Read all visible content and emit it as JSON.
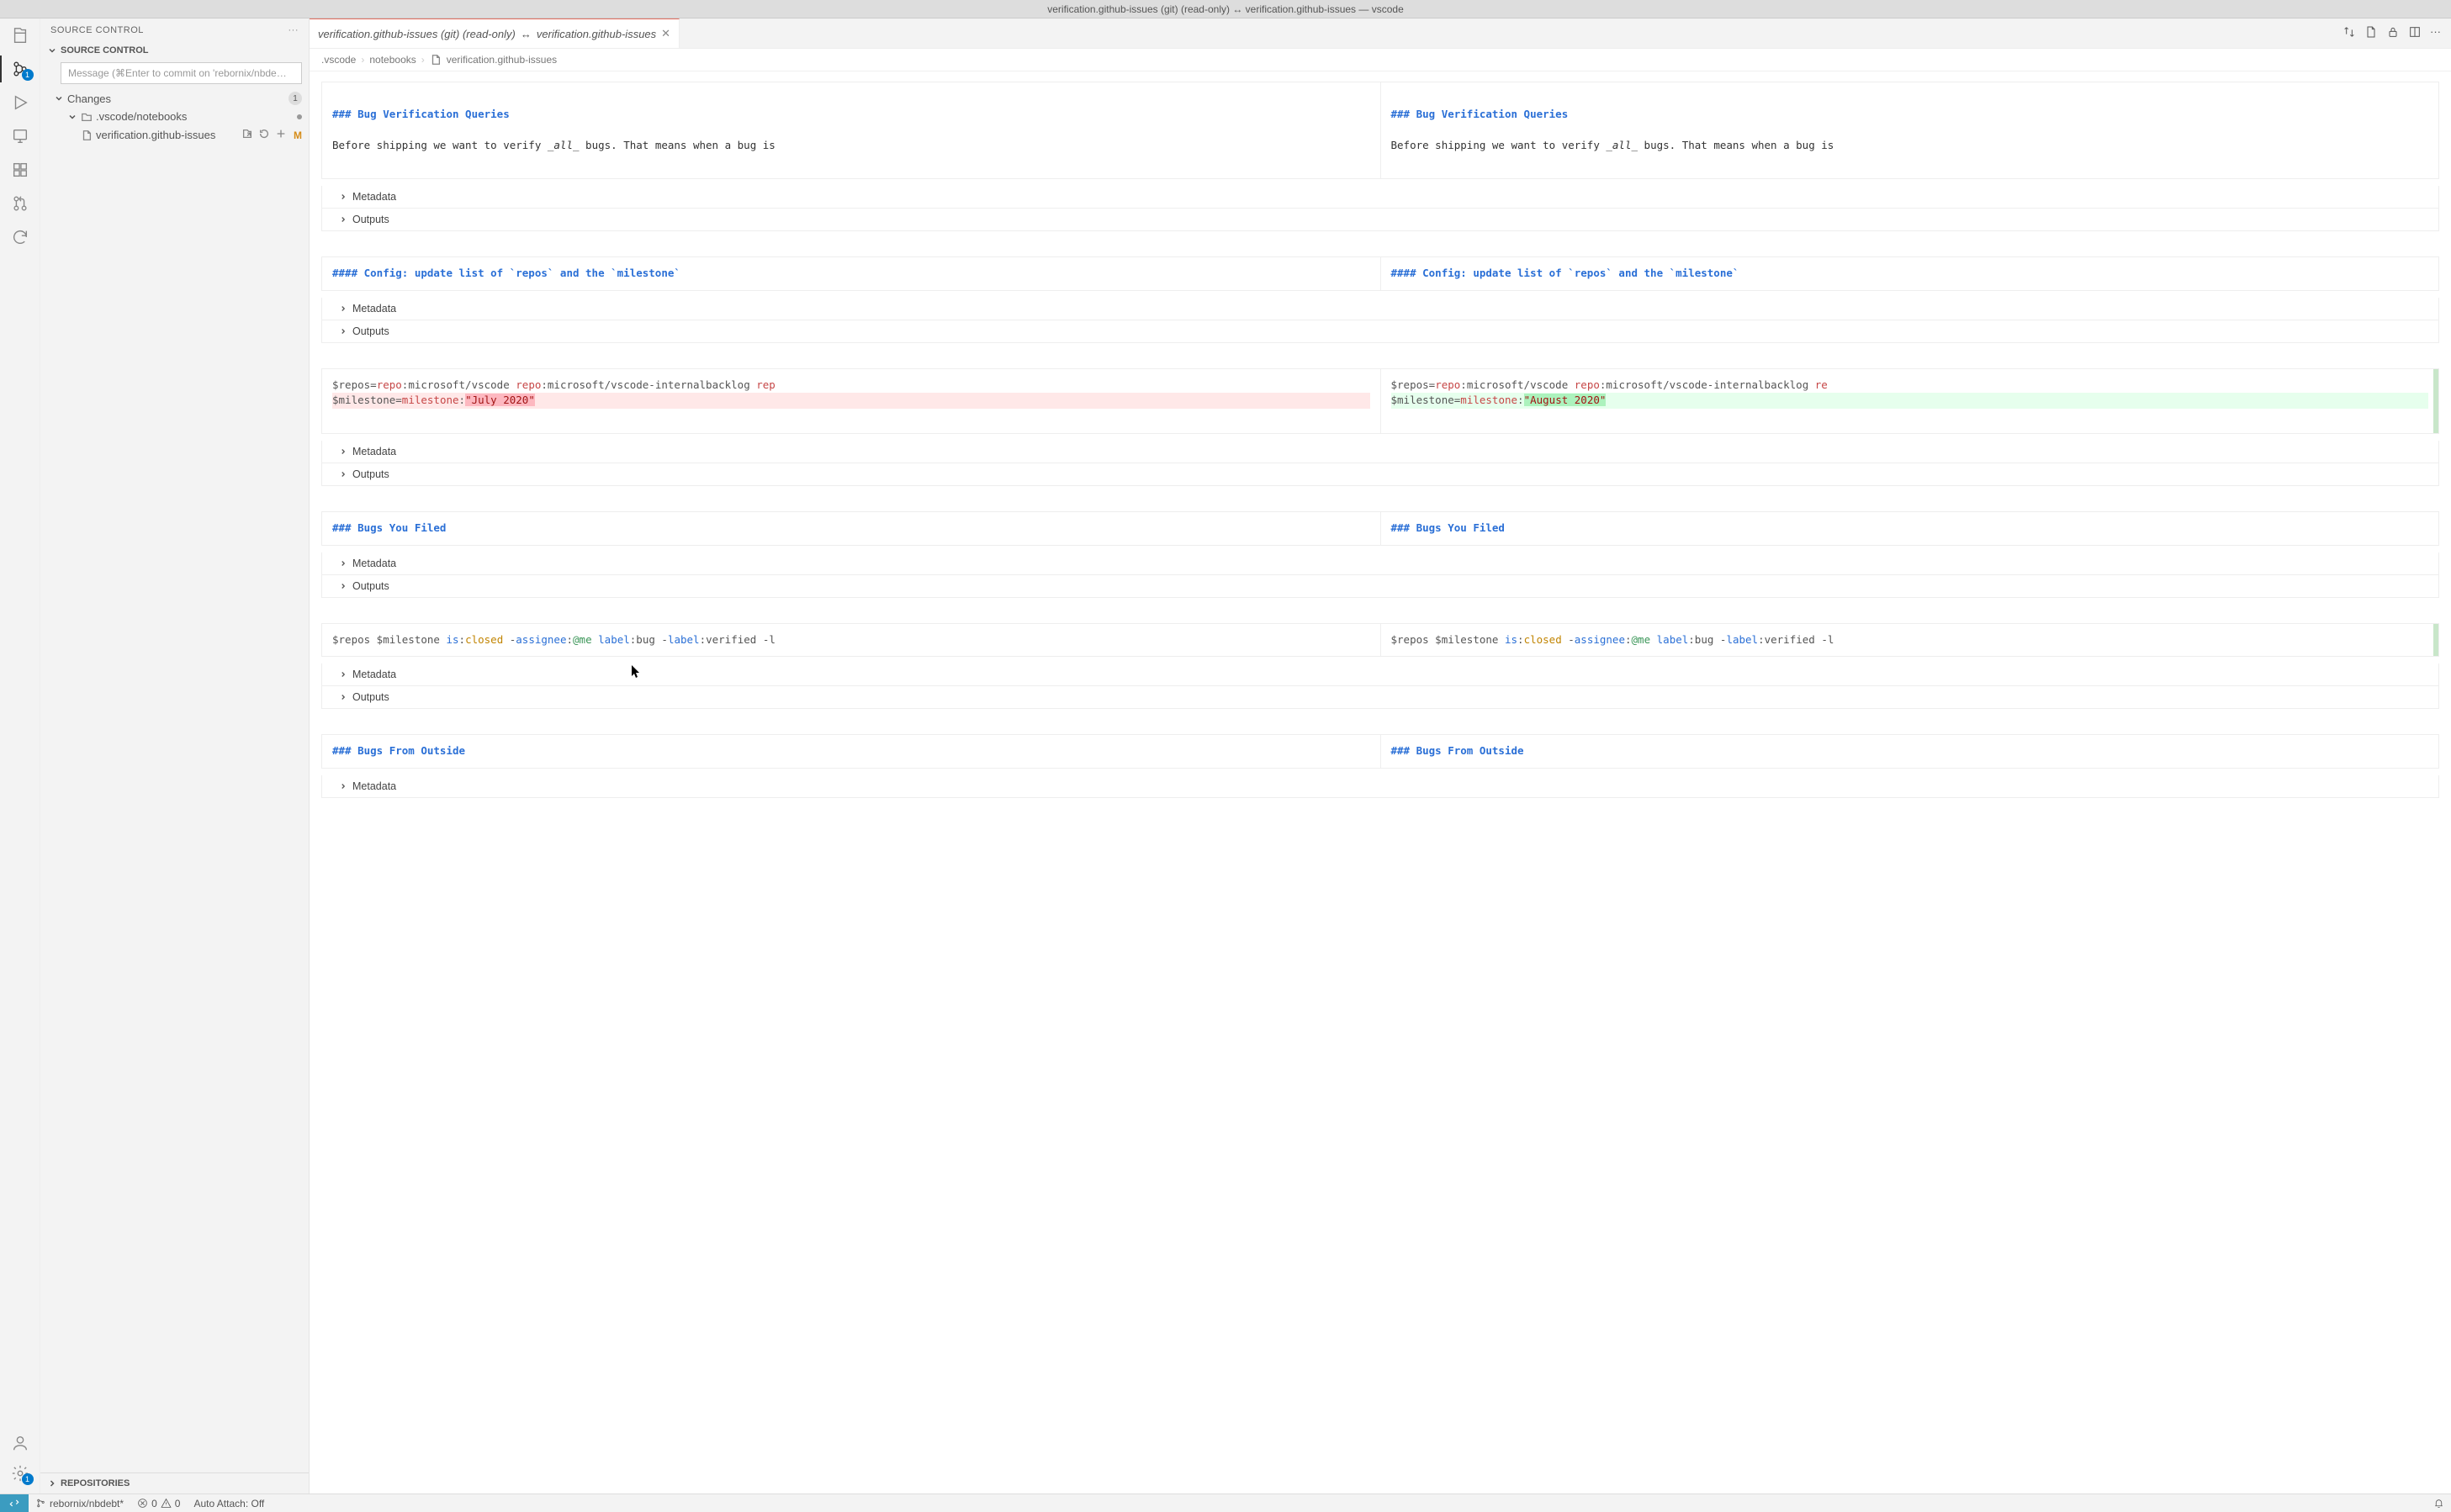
{
  "window": {
    "title": "verification.github-issues (git) (read-only) ↔ verification.github-issues — vscode"
  },
  "activityBar": {
    "badges": {
      "scm": "1",
      "settings": "1"
    }
  },
  "sidebar": {
    "title": "SOURCE CONTROL",
    "sections": {
      "sourceControl": "SOURCE CONTROL",
      "repositories": "REPOSITORIES"
    },
    "commitPlaceholder": "Message (⌘Enter to commit on 'rebornix/nbde…",
    "changes": {
      "label": "Changes",
      "count": "1",
      "folder": ".vscode/notebooks",
      "file": "verification.github-issues",
      "fileStatus": "M"
    }
  },
  "tab": {
    "left": "verification.github-issues (git) (read-only)",
    "sep": "↔",
    "right": "verification.github-issues"
  },
  "breadcrumbs": {
    "p1": ".vscode",
    "p2": "notebooks",
    "p3": "verification.github-issues"
  },
  "collapsibles": {
    "metadata": "Metadata",
    "outputs": "Outputs"
  },
  "chart_data": null,
  "cells": [
    {
      "type": "markdown",
      "left": {
        "heading": "### Bug Verification Queries",
        "body_prefix": "Before shipping we want to verify ",
        "body_em": "all",
        "body_suffix": " bugs. That means when a bug is"
      },
      "right": {
        "heading": "### Bug Verification Queries",
        "body_prefix": "Before shipping we want to verify ",
        "body_em": "all",
        "body_suffix": " bugs. That means when a bug is"
      }
    },
    {
      "type": "markdown-short",
      "left": "#### Config: update list of `repos` and the `milestone`",
      "right": "#### Config: update list of `repos` and the `milestone`"
    },
    {
      "type": "code-diff",
      "left": {
        "line1": {
          "prefix": "$repos=",
          "k1": "repo",
          "v1": ":microsoft/vscode ",
          "k2": "repo",
          "v2": ":microsoft/vscode-internalbacklog ",
          "k3": "rep"
        },
        "line2": {
          "prefix": "$milestone=",
          "k1": "milestone",
          "sep": ":",
          "val": "\"July 2020\""
        }
      },
      "right": {
        "line1": {
          "prefix": "$repos=",
          "k1": "repo",
          "v1": ":microsoft/vscode ",
          "k2": "repo",
          "v2": ":microsoft/vscode-internalbacklog ",
          "k3": "re"
        },
        "line2": {
          "prefix": "$milestone=",
          "k1": "milestone",
          "sep": ":",
          "val": "\"August 2020\""
        }
      }
    },
    {
      "type": "markdown-short",
      "left": "### Bugs You Filed",
      "right": "### Bugs You Filed"
    },
    {
      "type": "code-query",
      "left": "$repos $milestone is:closed -assignee:@me label:bug -label:verified -l",
      "right": "$repos $milestone is:closed -assignee:@me label:bug -label:verified -l"
    },
    {
      "type": "markdown-short-last",
      "left": "### Bugs From Outside",
      "right": "### Bugs From Outside"
    }
  ],
  "statusbar": {
    "branch": "rebornix/nbdebt*",
    "errors": "0",
    "warnings": "0",
    "autoAttach": "Auto Attach: Off"
  }
}
